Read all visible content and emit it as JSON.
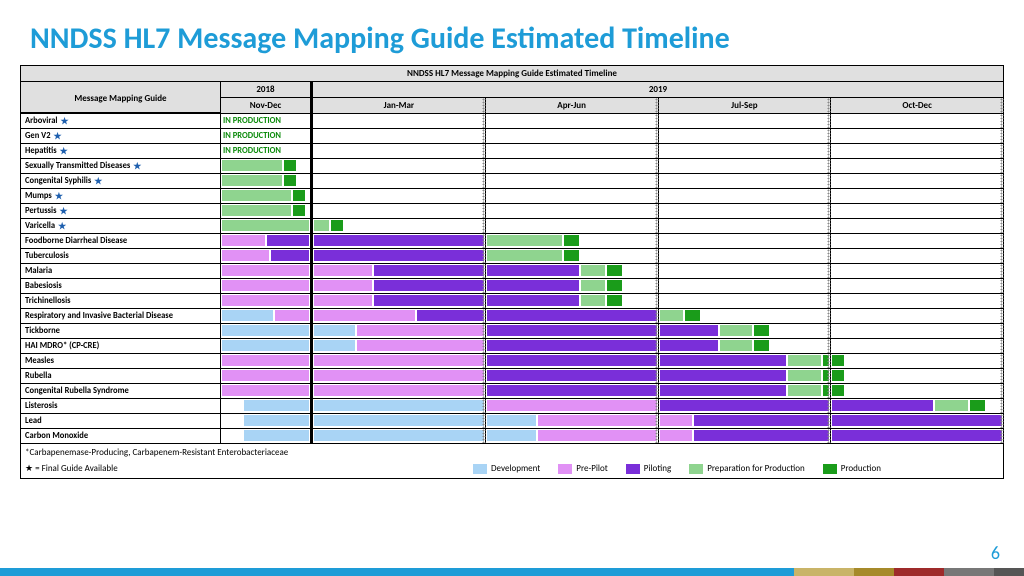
{
  "slide_title": "NNDSS HL7 Message Mapping Guide Estimated Timeline",
  "table_title": "NNDSS HL7 Message Mapping Guide Estimated Timeline",
  "header_label": "Message Mapping Guide",
  "year_2018": "2018",
  "year_2019": "2019",
  "sub_2018": "Nov-Dec",
  "q1": "Jan-Mar",
  "q2": "Apr-Jun",
  "q3": "Jul-Sep",
  "q4": "Oct-Dec",
  "chart_data": {
    "type": "gantt",
    "time_axis": {
      "2018": [
        "Nov-Dec"
      ],
      "2019": [
        "Jan-Mar",
        "Apr-Jun",
        "Jul-Sep",
        "Oct-Dec"
      ]
    },
    "phases": [
      "Development",
      "Pre-Pilot",
      "Piloting",
      "Preparation for Production",
      "Production"
    ],
    "rows": [
      {
        "name": "Arboviral",
        "star": true,
        "status_2018": "IN PRODUCTION",
        "segments": []
      },
      {
        "name": "Gen V2",
        "star": true,
        "status_2018": "IN PRODUCTION",
        "segments": []
      },
      {
        "name": "Hepatitis",
        "star": true,
        "status_2018": "IN PRODUCTION",
        "segments": []
      },
      {
        "name": "Sexually Transmitted Diseases",
        "star": true,
        "segments_2018": [
          {
            "phase": "prep",
            "start": 0,
            "end": 70
          },
          {
            "phase": "prod",
            "start": 70,
            "end": 85
          }
        ],
        "segments": []
      },
      {
        "name": "Congenital Syphilis",
        "star": true,
        "segments_2018": [
          {
            "phase": "prep",
            "start": 0,
            "end": 70
          },
          {
            "phase": "prod",
            "start": 70,
            "end": 85
          }
        ],
        "segments": []
      },
      {
        "name": "Mumps",
        "star": true,
        "segments_2018": [
          {
            "phase": "prep",
            "start": 0,
            "end": 80
          },
          {
            "phase": "prod",
            "start": 80,
            "end": 95
          }
        ],
        "segments": []
      },
      {
        "name": "Pertussis",
        "star": true,
        "segments_2018": [
          {
            "phase": "prep",
            "start": 0,
            "end": 80
          },
          {
            "phase": "prod",
            "start": 80,
            "end": 95
          }
        ],
        "segments": []
      },
      {
        "name": "Varicella",
        "star": true,
        "segments_2018": [
          {
            "phase": "prep",
            "start": 0,
            "end": 100
          }
        ],
        "segments_2019": [
          {
            "q": 1,
            "phase": "prep",
            "start": 0,
            "end": 10
          },
          {
            "q": 1,
            "phase": "prod",
            "start": 10,
            "end": 18
          }
        ]
      },
      {
        "name": "Foodborne Diarrheal Disease",
        "segments_2018": [
          {
            "phase": "prepilot",
            "start": 0,
            "end": 50
          },
          {
            "phase": "pilot",
            "start": 50,
            "end": 100
          }
        ],
        "segments_2019": [
          {
            "q": 1,
            "phase": "pilot",
            "start": 0,
            "end": 100
          },
          {
            "q": 2,
            "phase": "prep",
            "start": 0,
            "end": 45
          },
          {
            "q": 2,
            "phase": "prod",
            "start": 45,
            "end": 55
          }
        ]
      },
      {
        "name": "Tuberculosis",
        "segments_2018": [
          {
            "phase": "prepilot",
            "start": 0,
            "end": 55
          },
          {
            "phase": "pilot",
            "start": 55,
            "end": 100
          }
        ],
        "segments_2019": [
          {
            "q": 1,
            "phase": "pilot",
            "start": 0,
            "end": 100
          },
          {
            "q": 2,
            "phase": "prep",
            "start": 0,
            "end": 45
          },
          {
            "q": 2,
            "phase": "prod",
            "start": 45,
            "end": 55
          }
        ]
      },
      {
        "name": "Malaria",
        "segments_2018": [
          {
            "phase": "prepilot",
            "start": 0,
            "end": 100
          }
        ],
        "segments_2019": [
          {
            "q": 1,
            "phase": "prepilot",
            "start": 0,
            "end": 35
          },
          {
            "q": 1,
            "phase": "pilot",
            "start": 35,
            "end": 100
          },
          {
            "q": 2,
            "phase": "pilot",
            "start": 0,
            "end": 55
          },
          {
            "q": 2,
            "phase": "prep",
            "start": 55,
            "end": 70
          },
          {
            "q": 2,
            "phase": "prod",
            "start": 70,
            "end": 80
          }
        ]
      },
      {
        "name": "Babesiosis",
        "segments_2018": [
          {
            "phase": "prepilot",
            "start": 0,
            "end": 100
          }
        ],
        "segments_2019": [
          {
            "q": 1,
            "phase": "prepilot",
            "start": 0,
            "end": 35
          },
          {
            "q": 1,
            "phase": "pilot",
            "start": 35,
            "end": 100
          },
          {
            "q": 2,
            "phase": "pilot",
            "start": 0,
            "end": 55
          },
          {
            "q": 2,
            "phase": "prep",
            "start": 55,
            "end": 70
          },
          {
            "q": 2,
            "phase": "prod",
            "start": 70,
            "end": 80
          }
        ]
      },
      {
        "name": "Trichinellosis",
        "segments_2018": [
          {
            "phase": "prepilot",
            "start": 0,
            "end": 100
          }
        ],
        "segments_2019": [
          {
            "q": 1,
            "phase": "prepilot",
            "start": 0,
            "end": 35
          },
          {
            "q": 1,
            "phase": "pilot",
            "start": 35,
            "end": 100
          },
          {
            "q": 2,
            "phase": "pilot",
            "start": 0,
            "end": 55
          },
          {
            "q": 2,
            "phase": "prep",
            "start": 55,
            "end": 70
          },
          {
            "q": 2,
            "phase": "prod",
            "start": 70,
            "end": 80
          }
        ]
      },
      {
        "name": "Respiratory and Invasive Bacterial Disease",
        "segments_2018": [
          {
            "phase": "dev",
            "start": 0,
            "end": 60
          },
          {
            "phase": "prepilot",
            "start": 60,
            "end": 100
          }
        ],
        "segments_2019": [
          {
            "q": 1,
            "phase": "prepilot",
            "start": 0,
            "end": 60
          },
          {
            "q": 1,
            "phase": "pilot",
            "start": 60,
            "end": 100
          },
          {
            "q": 2,
            "phase": "pilot",
            "start": 0,
            "end": 100
          },
          {
            "q": 3,
            "phase": "prep",
            "start": 0,
            "end": 15
          },
          {
            "q": 3,
            "phase": "prod",
            "start": 15,
            "end": 25
          }
        ]
      },
      {
        "name": "Tickborne",
        "segments_2018": [
          {
            "phase": "dev",
            "start": 0,
            "end": 100
          }
        ],
        "segments_2019": [
          {
            "q": 1,
            "phase": "dev",
            "start": 0,
            "end": 25
          },
          {
            "q": 1,
            "phase": "prepilot",
            "start": 25,
            "end": 100
          },
          {
            "q": 2,
            "phase": "pilot",
            "start": 0,
            "end": 100
          },
          {
            "q": 3,
            "phase": "pilot",
            "start": 0,
            "end": 35
          },
          {
            "q": 3,
            "phase": "prep",
            "start": 35,
            "end": 55
          },
          {
            "q": 3,
            "phase": "prod",
            "start": 55,
            "end": 65
          }
        ]
      },
      {
        "name": "HAI MDRO* (CP-CRE)",
        "segments_2018": [
          {
            "phase": "dev",
            "start": 0,
            "end": 100
          }
        ],
        "segments_2019": [
          {
            "q": 1,
            "phase": "dev",
            "start": 0,
            "end": 25
          },
          {
            "q": 1,
            "phase": "prepilot",
            "start": 25,
            "end": 100
          },
          {
            "q": 2,
            "phase": "pilot",
            "start": 0,
            "end": 100
          },
          {
            "q": 3,
            "phase": "pilot",
            "start": 0,
            "end": 35
          },
          {
            "q": 3,
            "phase": "prep",
            "start": 35,
            "end": 55
          },
          {
            "q": 3,
            "phase": "prod",
            "start": 55,
            "end": 65
          }
        ]
      },
      {
        "name": "Measles",
        "segments_2018": [
          {
            "phase": "prepilot",
            "start": 0,
            "end": 100
          }
        ],
        "segments_2019": [
          {
            "q": 1,
            "phase": "prepilot",
            "start": 0,
            "end": 100
          },
          {
            "q": 2,
            "phase": "pilot",
            "start": 0,
            "end": 100
          },
          {
            "q": 3,
            "phase": "pilot",
            "start": 0,
            "end": 75
          },
          {
            "q": 3,
            "phase": "prep",
            "start": 75,
            "end": 95
          },
          {
            "q": 3,
            "phase": "prod",
            "start": 95,
            "end": 100
          },
          {
            "q": 4,
            "phase": "prod",
            "start": 0,
            "end": 8
          }
        ]
      },
      {
        "name": "Rubella",
        "segments_2018": [
          {
            "phase": "prepilot",
            "start": 0,
            "end": 100
          }
        ],
        "segments_2019": [
          {
            "q": 1,
            "phase": "prepilot",
            "start": 0,
            "end": 100
          },
          {
            "q": 2,
            "phase": "pilot",
            "start": 0,
            "end": 100
          },
          {
            "q": 3,
            "phase": "pilot",
            "start": 0,
            "end": 75
          },
          {
            "q": 3,
            "phase": "prep",
            "start": 75,
            "end": 95
          },
          {
            "q": 3,
            "phase": "prod",
            "start": 95,
            "end": 100
          },
          {
            "q": 4,
            "phase": "prod",
            "start": 0,
            "end": 8
          }
        ]
      },
      {
        "name": "Congenital Rubella Syndrome",
        "segments_2018": [
          {
            "phase": "prepilot",
            "start": 0,
            "end": 100
          }
        ],
        "segments_2019": [
          {
            "q": 1,
            "phase": "prepilot",
            "start": 0,
            "end": 100
          },
          {
            "q": 2,
            "phase": "pilot",
            "start": 0,
            "end": 100
          },
          {
            "q": 3,
            "phase": "pilot",
            "start": 0,
            "end": 75
          },
          {
            "q": 3,
            "phase": "prep",
            "start": 75,
            "end": 95
          },
          {
            "q": 3,
            "phase": "prod",
            "start": 95,
            "end": 100
          },
          {
            "q": 4,
            "phase": "prod",
            "start": 0,
            "end": 8
          }
        ]
      },
      {
        "name": "Listerosis",
        "segments_2018": [
          {
            "phase": "dev",
            "start": 25,
            "end": 100
          }
        ],
        "segments_2019": [
          {
            "q": 1,
            "phase": "dev",
            "start": 0,
            "end": 100
          },
          {
            "q": 2,
            "phase": "prepilot",
            "start": 0,
            "end": 100
          },
          {
            "q": 3,
            "phase": "pilot",
            "start": 0,
            "end": 100
          },
          {
            "q": 4,
            "phase": "pilot",
            "start": 0,
            "end": 60
          },
          {
            "q": 4,
            "phase": "prep",
            "start": 60,
            "end": 80
          },
          {
            "q": 4,
            "phase": "prod",
            "start": 80,
            "end": 90
          }
        ]
      },
      {
        "name": "Lead",
        "segments_2018": [
          {
            "phase": "dev",
            "start": 25,
            "end": 100
          }
        ],
        "segments_2019": [
          {
            "q": 1,
            "phase": "dev",
            "start": 0,
            "end": 100
          },
          {
            "q": 2,
            "phase": "dev",
            "start": 0,
            "end": 30
          },
          {
            "q": 2,
            "phase": "prepilot",
            "start": 30,
            "end": 100
          },
          {
            "q": 3,
            "phase": "prepilot",
            "start": 0,
            "end": 20
          },
          {
            "q": 3,
            "phase": "pilot",
            "start": 20,
            "end": 100
          },
          {
            "q": 4,
            "phase": "pilot",
            "start": 0,
            "end": 100
          }
        ]
      },
      {
        "name": "Carbon Monoxide",
        "segments_2018": [
          {
            "phase": "dev",
            "start": 25,
            "end": 100
          }
        ],
        "segments_2019": [
          {
            "q": 1,
            "phase": "dev",
            "start": 0,
            "end": 100
          },
          {
            "q": 2,
            "phase": "dev",
            "start": 0,
            "end": 30
          },
          {
            "q": 2,
            "phase": "prepilot",
            "start": 30,
            "end": 100
          },
          {
            "q": 3,
            "phase": "prepilot",
            "start": 0,
            "end": 20
          },
          {
            "q": 3,
            "phase": "pilot",
            "start": 20,
            "end": 100
          },
          {
            "q": 4,
            "phase": "pilot",
            "start": 0,
            "end": 100
          }
        ]
      }
    ]
  },
  "footnote1": "*Carbapenemase-Producing, Carbapenem-Resistant Enterobacteriaceae",
  "footnote2": "★ = Final Guide Available",
  "legend": {
    "dev": "Development",
    "prepilot": "Pre-Pilot",
    "pilot": "Piloting",
    "prep": "Preparation for Production",
    "prod": "Production"
  },
  "colors": {
    "dev": "#a9d4f5",
    "prepilot": "#e191f5",
    "pilot": "#7a2fd9",
    "prep": "#8fd48f",
    "prod": "#1a9c1a"
  },
  "page_number": "6"
}
